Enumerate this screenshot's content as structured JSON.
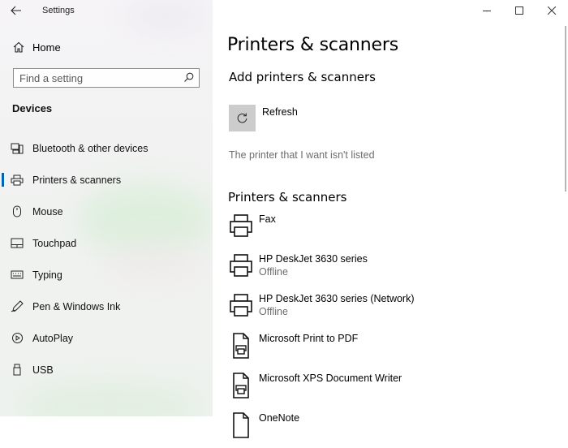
{
  "app": {
    "title": "Settings"
  },
  "sidebar": {
    "home_label": "Home",
    "search_placeholder": "Find a setting",
    "section_title": "Devices",
    "items": [
      {
        "label": "Bluetooth & other devices",
        "icon": "bluetooth-devices-icon"
      },
      {
        "label": "Printers & scanners",
        "icon": "printer-icon",
        "active": true
      },
      {
        "label": "Mouse",
        "icon": "mouse-icon"
      },
      {
        "label": "Touchpad",
        "icon": "touchpad-icon"
      },
      {
        "label": "Typing",
        "icon": "keyboard-icon"
      },
      {
        "label": "Pen & Windows Ink",
        "icon": "pen-icon"
      },
      {
        "label": "AutoPlay",
        "icon": "autoplay-icon"
      },
      {
        "label": "USB",
        "icon": "usb-icon"
      }
    ]
  },
  "content": {
    "page_title": "Printers & scanners",
    "add_section_title": "Add printers & scanners",
    "refresh_label": "Refresh",
    "not_listed_link": "The printer that I want isn't listed",
    "list_section_title": "Printers & scanners",
    "printers": [
      {
        "name": "Fax",
        "status": "",
        "icon": "printer-icon"
      },
      {
        "name": "HP DeskJet 3630 series",
        "status": "Offline",
        "icon": "printer-icon"
      },
      {
        "name": "HP DeskJet 3630 series (Network)",
        "status": "Offline",
        "icon": "printer-icon"
      },
      {
        "name": "Microsoft Print to PDF",
        "status": "",
        "icon": "document-printer-icon"
      },
      {
        "name": "Microsoft XPS Document Writer",
        "status": "",
        "icon": "document-printer-icon"
      },
      {
        "name": "OneNote",
        "status": "",
        "icon": "document-printer-icon"
      }
    ]
  },
  "colors": {
    "accent": "#0063b1",
    "refresh_tile": "#cccccc",
    "secondary_text": "#6d6d6d"
  }
}
